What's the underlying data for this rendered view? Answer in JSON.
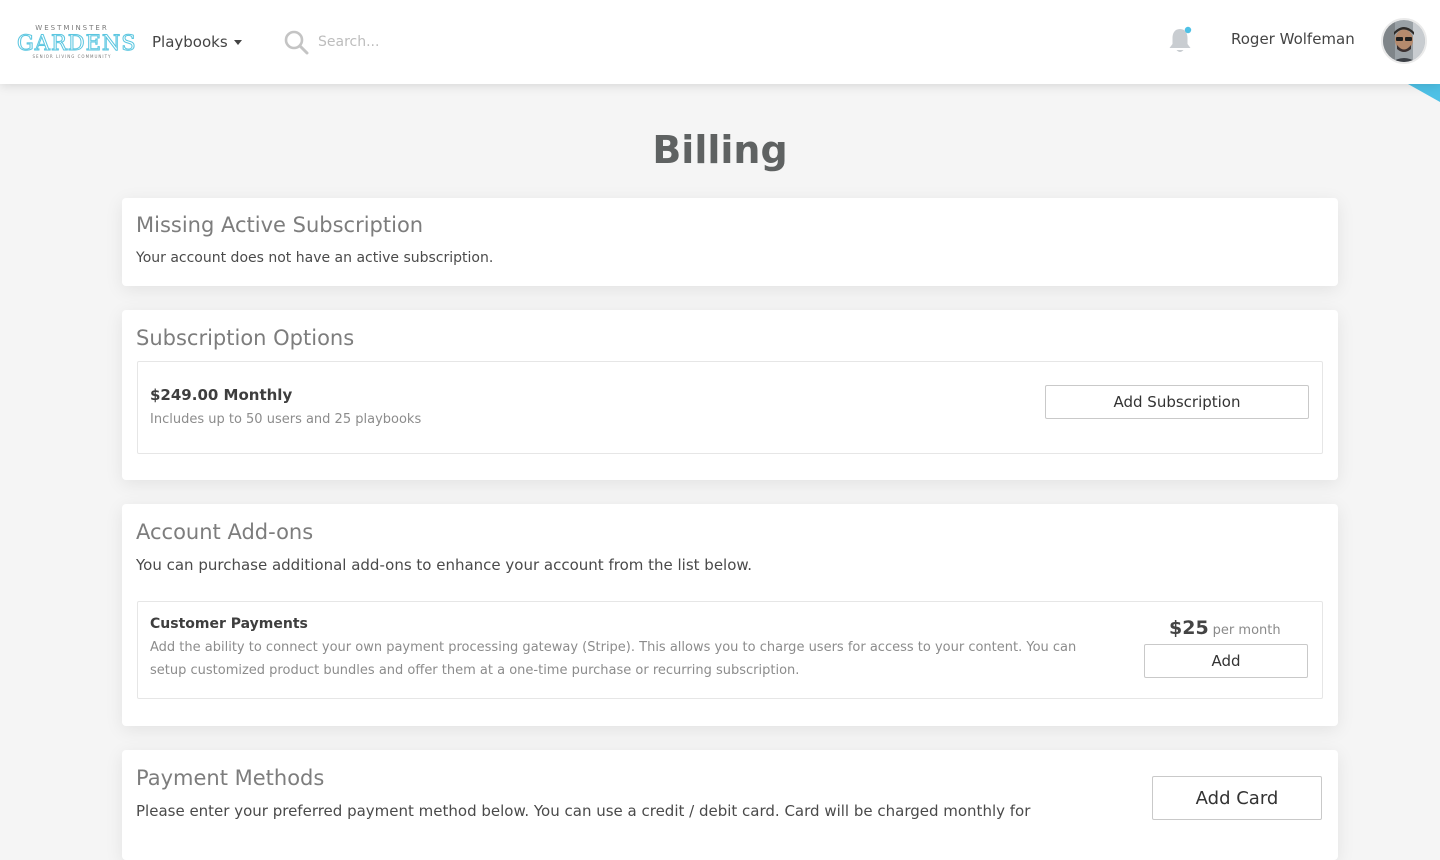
{
  "header": {
    "logo": {
      "top": "WESTMINSTER",
      "main": "GARDENS",
      "sub": "SENIOR LIVING COMMUNITY"
    },
    "nav_playbooks": "Playbooks",
    "search_placeholder": "Search...",
    "user_name": "Roger Wolfeman",
    "icons": {
      "search": "search-icon",
      "notifications": "bell-icon",
      "avatar": "user-avatar"
    },
    "colors": {
      "brand": "#5bc6e0",
      "notification_dot": "#4ec1e6"
    }
  },
  "page": {
    "title": "Billing"
  },
  "missing_subscription": {
    "title": "Missing Active Subscription",
    "text": "Your account does not have an active subscription."
  },
  "subscription_options": {
    "title": "Subscription Options",
    "plan": {
      "name": "$249.00 Monthly",
      "description": "Includes up to 50 users and 25 playbooks",
      "button": "Add Subscription"
    }
  },
  "addons": {
    "title": "Account Add-ons",
    "text": "You can purchase additional add-ons to enhance your account from the list below.",
    "item": {
      "name": "Customer Payments",
      "description": "Add the ability to connect your own payment processing gateway (Stripe). This allows you to charge users for access to your content. You can setup customized product bundles and offer them at a one-time purchase or recurring subscription.",
      "price": "$25",
      "price_unit": "per month",
      "button": "Add"
    }
  },
  "payment_methods": {
    "title": "Payment Methods",
    "text": "Please enter your preferred payment method below. You can use a credit / debit card. Card will be charged monthly for",
    "button": "Add Card"
  }
}
